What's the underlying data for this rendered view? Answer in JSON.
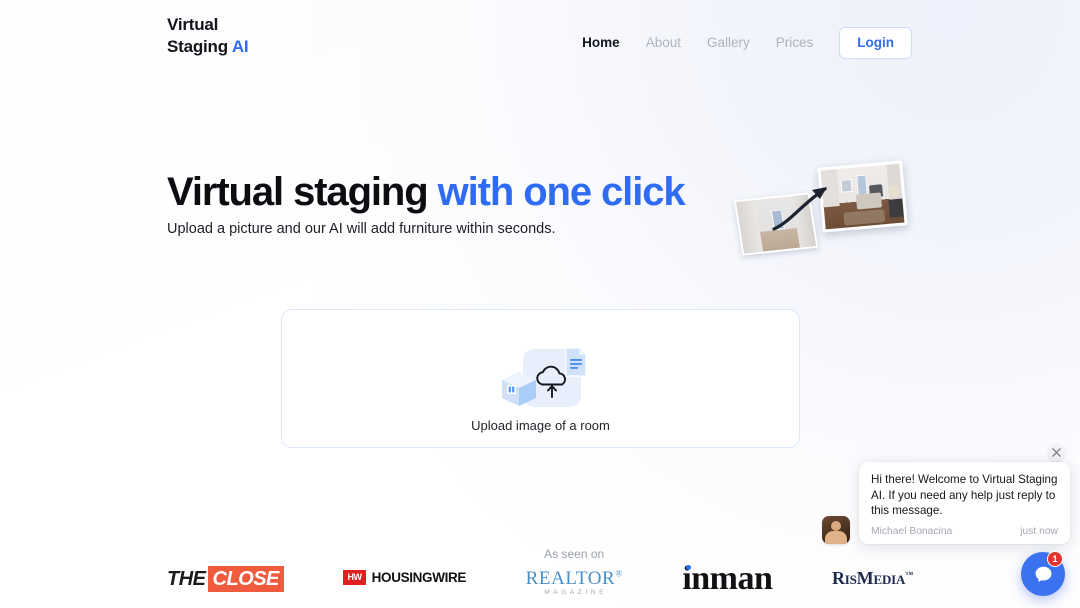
{
  "brand": {
    "line1": "Virtual",
    "line2": "Staging",
    "highlight": "AI",
    "accent_color": "#2f6bf3"
  },
  "nav": {
    "items": [
      {
        "label": "Home",
        "active": true
      },
      {
        "label": "About",
        "active": false
      },
      {
        "label": "Gallery",
        "active": false
      },
      {
        "label": "Prices",
        "active": false
      }
    ],
    "login_label": "Login"
  },
  "hero": {
    "title_plain": "Virtual staging ",
    "title_accent": "with one click",
    "subtitle": "Upload a picture and our AI will add furniture within seconds.",
    "art": {
      "before_alt": "empty room photo",
      "after_alt": "virtually staged bedroom photo",
      "arrow": "curved-arrow"
    }
  },
  "upload": {
    "label": "Upload image of a room",
    "icon": "upload-cloud-image-icon",
    "border_color": "#dbe6f9"
  },
  "press": {
    "seen_on_label": "As seen on",
    "logos": [
      {
        "name": "the-close",
        "text_1": "THE",
        "text_2": "CLOSE"
      },
      {
        "name": "housingwire",
        "mark": "HW",
        "text": "HOUSINGWIRE"
      },
      {
        "name": "realtor-magazine",
        "text": "REALTOR",
        "sup": "®",
        "sub": "MAGAZINE"
      },
      {
        "name": "inman",
        "text": "inman"
      },
      {
        "name": "rismedia",
        "text_1": "R",
        "text_2": "IS",
        "text_3": "M",
        "text_4": "EDIA",
        "sup": "™"
      }
    ]
  },
  "chat": {
    "message": "Hi there! Welcome to Virtual Staging AI. If you need any help just reply to this message.",
    "sender": "Michael Bonacina",
    "time": "just now",
    "close_icon": "close-icon",
    "bubble_icon": "chat-bubble-icon",
    "unread_count": "1",
    "fab_color": "#3b72ef",
    "badge_color": "#e3342f"
  }
}
